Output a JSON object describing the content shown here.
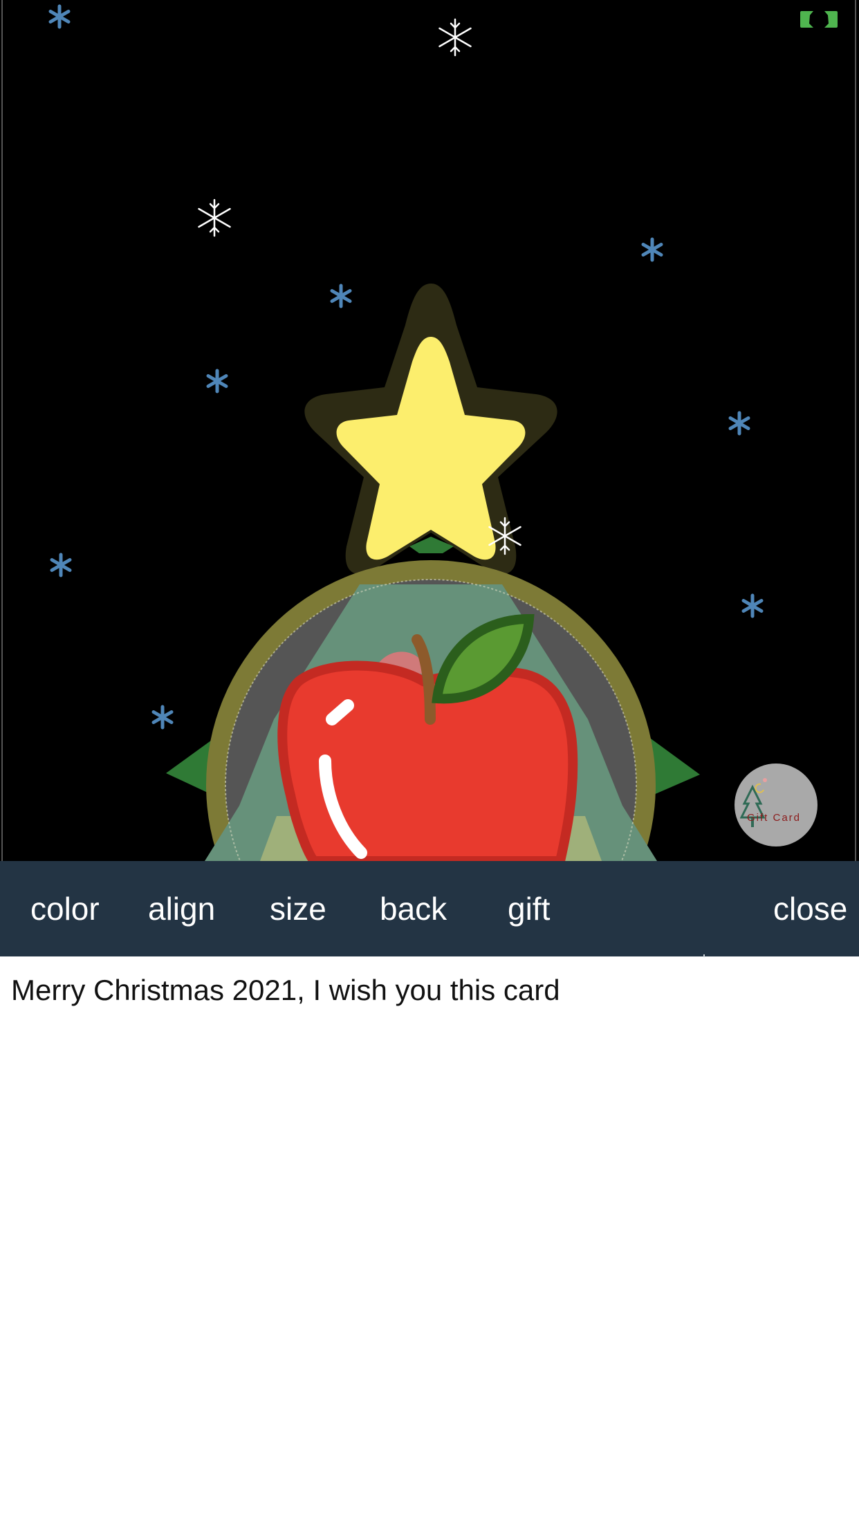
{
  "toolbar": {
    "color": "color",
    "align": "align",
    "size": "size",
    "back": "back",
    "gift": "gift",
    "close": "close"
  },
  "message": "Merry Christmas 2021, I wish you this card",
  "gift_badge": {
    "label": "Gift Card"
  },
  "colors": {
    "toolbar_bg": "#233444",
    "card_bg": "#000000",
    "star": "#fcee6d",
    "apple": "#e83a2e",
    "leaf": "#5a9a32",
    "ring": "#7d7a36",
    "fullscreen_icon": "#4fb54f"
  }
}
